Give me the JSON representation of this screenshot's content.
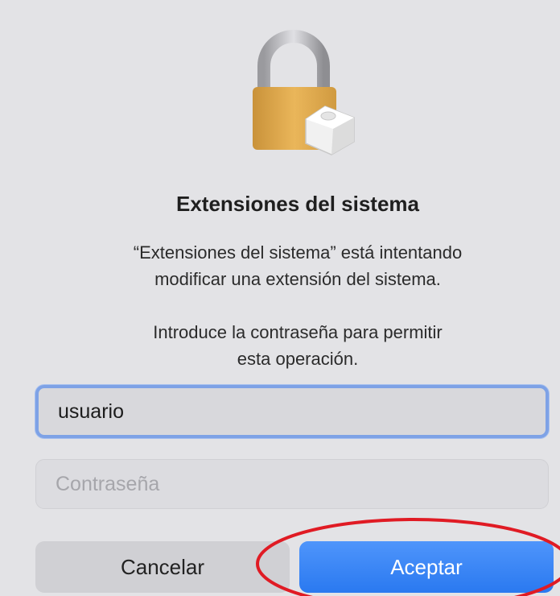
{
  "dialog": {
    "icon": "lock-with-extension-icon",
    "title": "Extensiones del sistema",
    "message1": {
      "line1": "“Extensiones del sistema” está intentando",
      "line2": "modificar una extensión del sistema."
    },
    "message2": {
      "line1": "Introduce la contraseña para permitir",
      "line2": "esta operación."
    },
    "username": {
      "value": "usuario"
    },
    "password": {
      "placeholder": "Contraseña",
      "value": ""
    },
    "buttons": {
      "cancel": "Cancelar",
      "accept": "Aceptar"
    }
  },
  "colors": {
    "accent": "#2f7ef5",
    "focus_ring": "#7ea2e6",
    "highlight": "#e01b24"
  }
}
